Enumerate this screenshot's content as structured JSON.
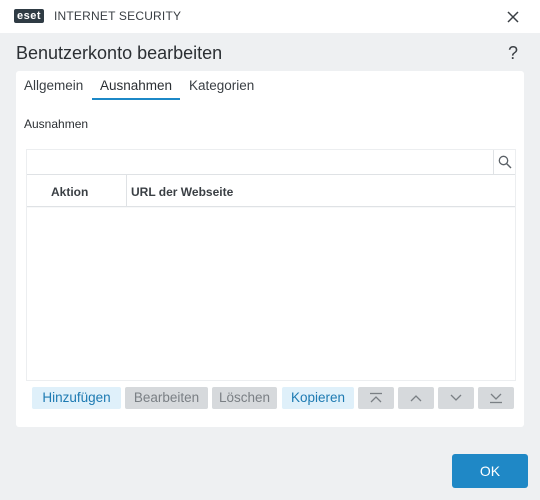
{
  "titlebar": {
    "logo": "eset",
    "app_name": "INTERNET SECURITY"
  },
  "dialog": {
    "title": "Benutzerkonto bearbeiten",
    "help": "?"
  },
  "tabs": [
    {
      "label": "Allgemein",
      "active": false
    },
    {
      "label": "Ausnahmen",
      "active": true
    },
    {
      "label": "Kategorien",
      "active": false
    }
  ],
  "section": {
    "label": "Ausnahmen"
  },
  "table": {
    "columns": [
      "Aktion",
      "URL der Webseite"
    ],
    "rows": []
  },
  "buttons": {
    "add": "Hinzufügen",
    "edit": "Bearbeiten",
    "delete": "Löschen",
    "copy": "Kopieren"
  },
  "footer": {
    "ok": "OK"
  },
  "colors": {
    "accent": "#1f88c6",
    "accent_light": "#dff0fa",
    "disabled": "#d6d9dc"
  }
}
